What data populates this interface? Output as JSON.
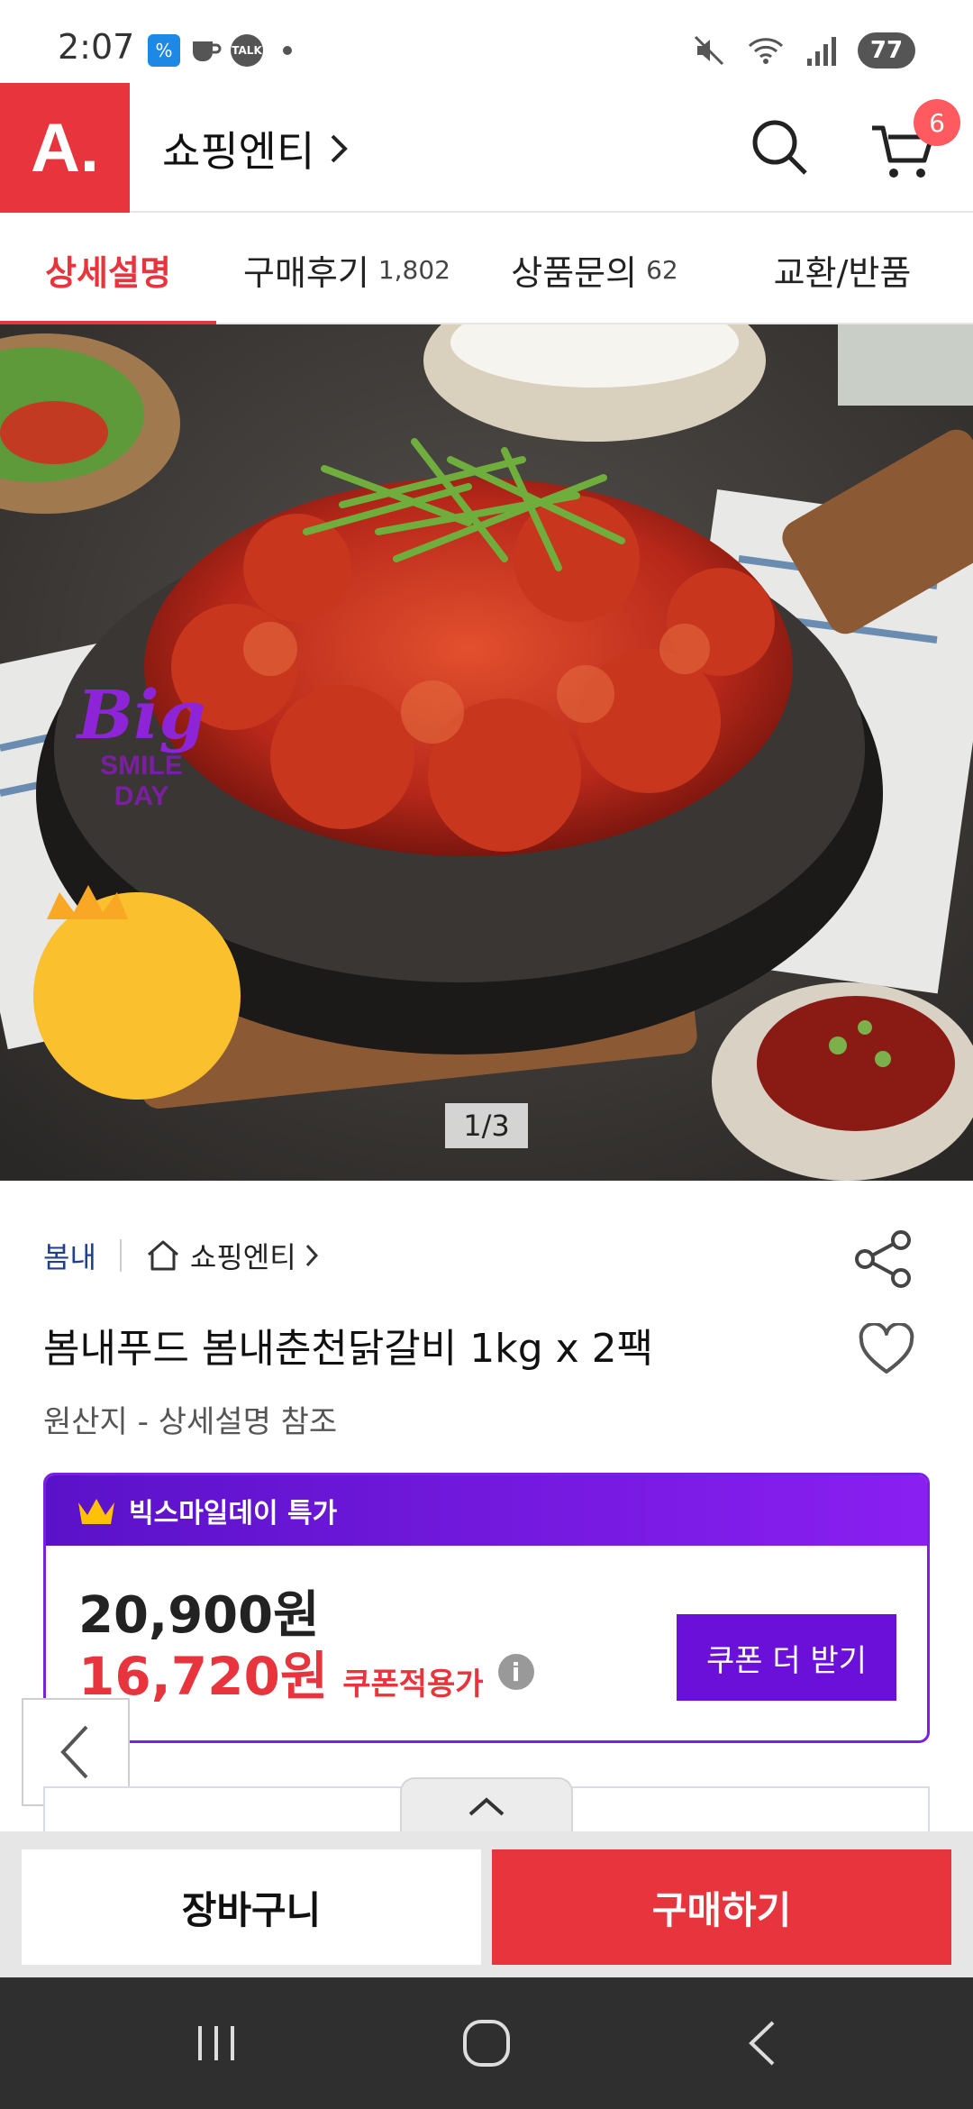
{
  "status_bar": {
    "time": "2:07",
    "battery": "77",
    "app_icons": [
      "percent-app-icon",
      "coffee-app-icon",
      "kakaotalk-icon"
    ],
    "kakaotalk_label": "TALK",
    "right_icons": [
      "mute-icon",
      "wifi-icon",
      "signal-icon"
    ]
  },
  "header": {
    "logo_text": "A.",
    "store_title": "쇼핑엔티",
    "cart_count": "6",
    "brand_color": "#e8343c"
  },
  "tabs": [
    {
      "label": "상세설명",
      "count": "",
      "active": true
    },
    {
      "label": "구매후기",
      "count": "1,802",
      "active": false
    },
    {
      "label": "상품문의",
      "count": "62",
      "active": false
    },
    {
      "label": "교환/반품",
      "count": "",
      "active": false
    }
  ],
  "hero": {
    "counter": "1/3",
    "badge_big": "Big",
    "badge_line1": "SMILE",
    "badge_line2": "DAY"
  },
  "product": {
    "brand": "봄내",
    "store_link": "쇼핑엔티",
    "title": "봄내푸드 봄내춘천닭갈비 1kg x 2팩",
    "origin": "원산지 - 상세설명 참조"
  },
  "deal": {
    "header": "빅스마일데이 특가",
    "original_price": "20,900원",
    "sale_price": "16,720원",
    "sale_label": "쿠폰적용가",
    "info_icon": "i",
    "coupon_button": "쿠폰 더 받기",
    "accent": "#6a10d8"
  },
  "actions": {
    "cart": "장바구니",
    "buy": "구매하기"
  }
}
